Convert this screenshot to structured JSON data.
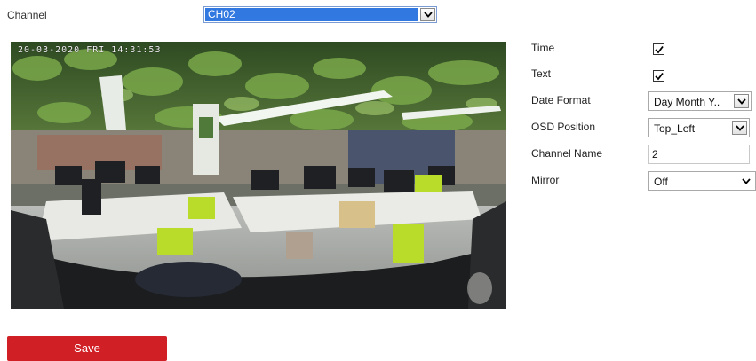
{
  "channel": {
    "label": "Channel",
    "selected": "CH02"
  },
  "preview": {
    "osd_text": "20-03-2020 FRI 14:31:53"
  },
  "settings": {
    "time": {
      "label": "Time",
      "checked": true
    },
    "text": {
      "label": "Text",
      "checked": true
    },
    "date_format": {
      "label": "Date Format",
      "value": "Day Month Y.."
    },
    "osd_position": {
      "label": "OSD Position",
      "value": "Top_Left"
    },
    "channel_name": {
      "label": "Channel Name",
      "value": "2"
    },
    "mirror": {
      "label": "Mirror",
      "value": "Off"
    }
  },
  "save_label": "Save",
  "icons": {
    "dropdown": "chevron-down-icon",
    "checkbox": "checkmark-icon"
  },
  "colors": {
    "save_button": "#d11f26",
    "selection_highlight": "#3178e0"
  }
}
